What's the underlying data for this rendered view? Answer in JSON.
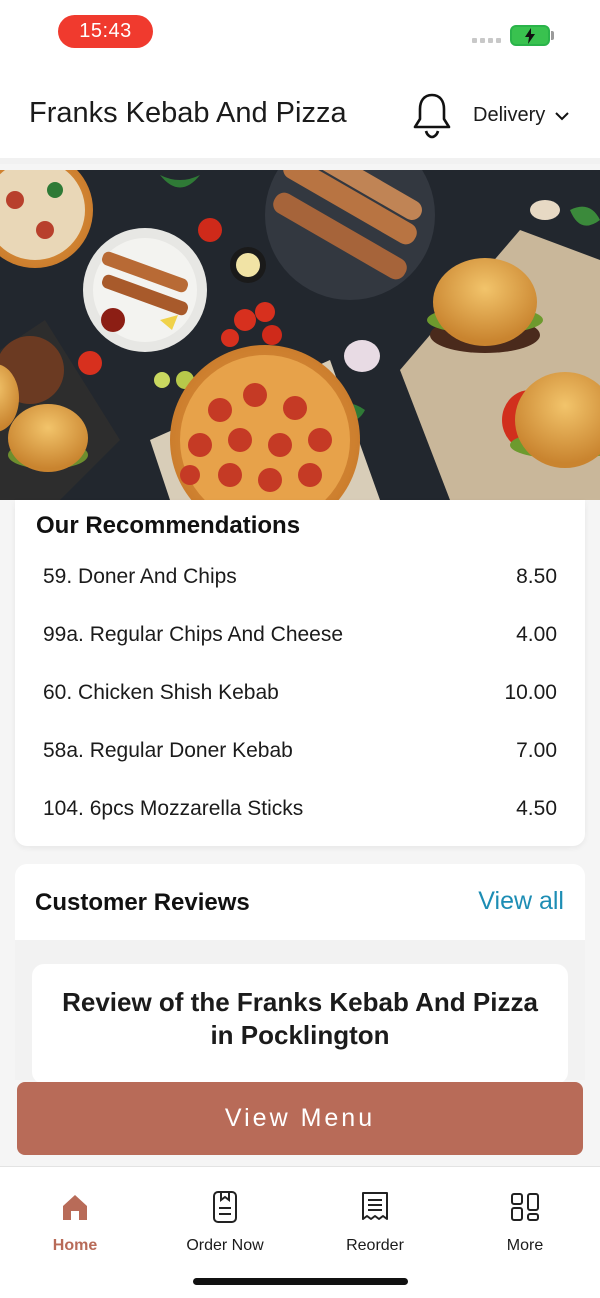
{
  "status_bar": {
    "time": "15:43"
  },
  "header": {
    "title": "Franks Kebab And Pizza",
    "mode_label": "Delivery"
  },
  "hero": {
    "alt": ""
  },
  "recommendations": {
    "title": "Our Recommendations",
    "items": [
      {
        "name": "59. Doner And Chips",
        "price": "8.50"
      },
      {
        "name": "99a. Regular Chips And Cheese",
        "price": "4.00"
      },
      {
        "name": "60. Chicken Shish Kebab",
        "price": "10.00"
      },
      {
        "name": "58a. Regular Doner Kebab",
        "price": "7.00"
      },
      {
        "name": "104. 6pcs Mozzarella Sticks",
        "price": "4.50"
      }
    ]
  },
  "reviews": {
    "title": "Customer Reviews",
    "view_all_label": "View all",
    "heading": "Review of the Franks Kebab And Pizza in Pocklington"
  },
  "cta": {
    "view_menu_label": "View Menu"
  },
  "nav": {
    "items": [
      {
        "label": "Home",
        "icon": "home-icon",
        "active": true
      },
      {
        "label": "Order Now",
        "icon": "order-now-icon",
        "active": false
      },
      {
        "label": "Reorder",
        "icon": "receipt-icon",
        "active": false
      },
      {
        "label": "More",
        "icon": "grid-icon",
        "active": false
      }
    ]
  },
  "colors": {
    "accent": "#b86b58",
    "link": "#1d8db4",
    "time_pill": "#f03a2e",
    "battery": "#39c24f"
  }
}
